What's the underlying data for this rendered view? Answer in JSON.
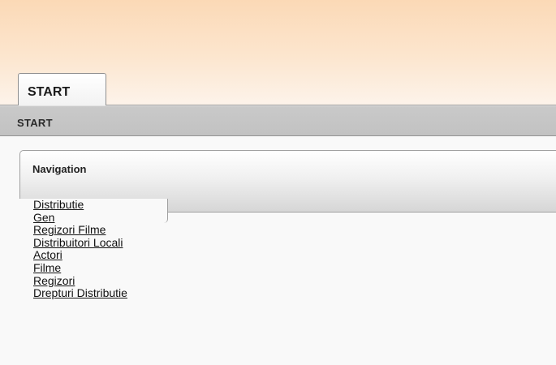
{
  "tabs": [
    {
      "label": "START"
    }
  ],
  "breadcrumb": {
    "label": "START"
  },
  "navigation": {
    "title": "Navigation",
    "links": [
      {
        "label": "Distributie"
      },
      {
        "label": "Gen"
      },
      {
        "label": "Regizori Filme"
      },
      {
        "label": "Distribuitori Locali"
      },
      {
        "label": "Actori"
      },
      {
        "label": "Filme"
      },
      {
        "label": "Regizori"
      },
      {
        "label": "Drepturi Distributie"
      }
    ]
  },
  "colors": {
    "header_top": "#fbd9b6",
    "header_bottom": "#fdf3ea",
    "subbar": "#c6c6c6",
    "panel_border": "#a0a0a0"
  }
}
